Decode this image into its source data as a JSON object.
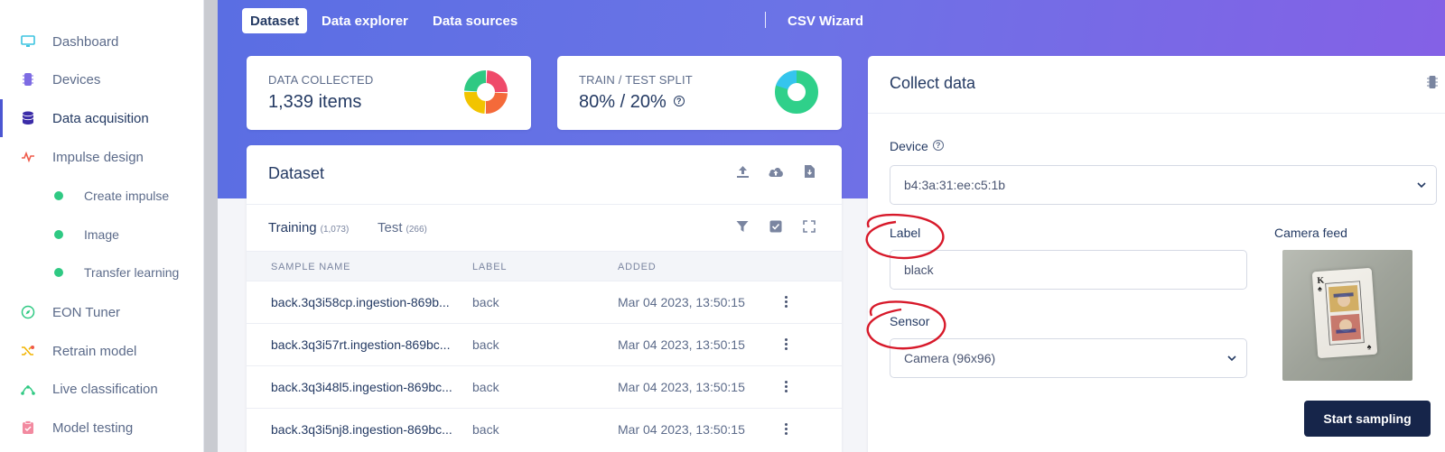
{
  "sidebar": {
    "items": [
      {
        "label": "Dashboard",
        "icon": "monitor-icon"
      },
      {
        "label": "Devices",
        "icon": "chip-icon"
      },
      {
        "label": "Data acquisition",
        "icon": "database-icon"
      },
      {
        "label": "Impulse design",
        "icon": "pulse-icon"
      },
      {
        "label": "Create impulse",
        "icon": "dot-icon"
      },
      {
        "label": "Image",
        "icon": "dot-icon"
      },
      {
        "label": "Transfer learning",
        "icon": "dot-icon"
      },
      {
        "label": "EON Tuner",
        "icon": "compass-icon"
      },
      {
        "label": "Retrain model",
        "icon": "shuffle-icon"
      },
      {
        "label": "Live classification",
        "icon": "node-icon"
      },
      {
        "label": "Model testing",
        "icon": "clipboard-check-icon"
      }
    ]
  },
  "tabs": [
    "Dataset",
    "Data explorer",
    "Data sources",
    "CSV Wizard"
  ],
  "stats": {
    "collected_label": "DATA COLLECTED",
    "collected_value": "1,339 items",
    "split_label": "TRAIN / TEST SPLIT",
    "split_value": "80% / 20%",
    "help_glyph": "?"
  },
  "dataset": {
    "title": "Dataset",
    "training_label": "Training",
    "training_count": "(1,073)",
    "test_label": "Test",
    "test_count": "(266)",
    "columns": [
      "SAMPLE NAME",
      "LABEL",
      "ADDED"
    ],
    "rows": [
      {
        "name": "back.3q3i58cp.ingestion-869b...",
        "label": "back",
        "added": "Mar 04 2023, 13:50:15"
      },
      {
        "name": "back.3q3i57rt.ingestion-869bc...",
        "label": "back",
        "added": "Mar 04 2023, 13:50:15"
      },
      {
        "name": "back.3q3i48l5.ingestion-869bc...",
        "label": "back",
        "added": "Mar 04 2023, 13:50:15"
      },
      {
        "name": "back.3q3i5nj8.ingestion-869bc...",
        "label": "back",
        "added": "Mar 04 2023, 13:50:15"
      }
    ]
  },
  "collect": {
    "title": "Collect data",
    "device_label": "Device",
    "device_value": "b4:3a:31:ee:c5:1b",
    "label_label": "Label",
    "label_value": "black",
    "sensor_label": "Sensor",
    "sensor_value": "Camera (96x96)",
    "camera_label": "Camera feed",
    "start_button": "Start sampling"
  },
  "colors": {
    "accent": "#4b56d2",
    "navy": "#16254a",
    "green": "#2fc983",
    "annotation": "#d7192a"
  }
}
